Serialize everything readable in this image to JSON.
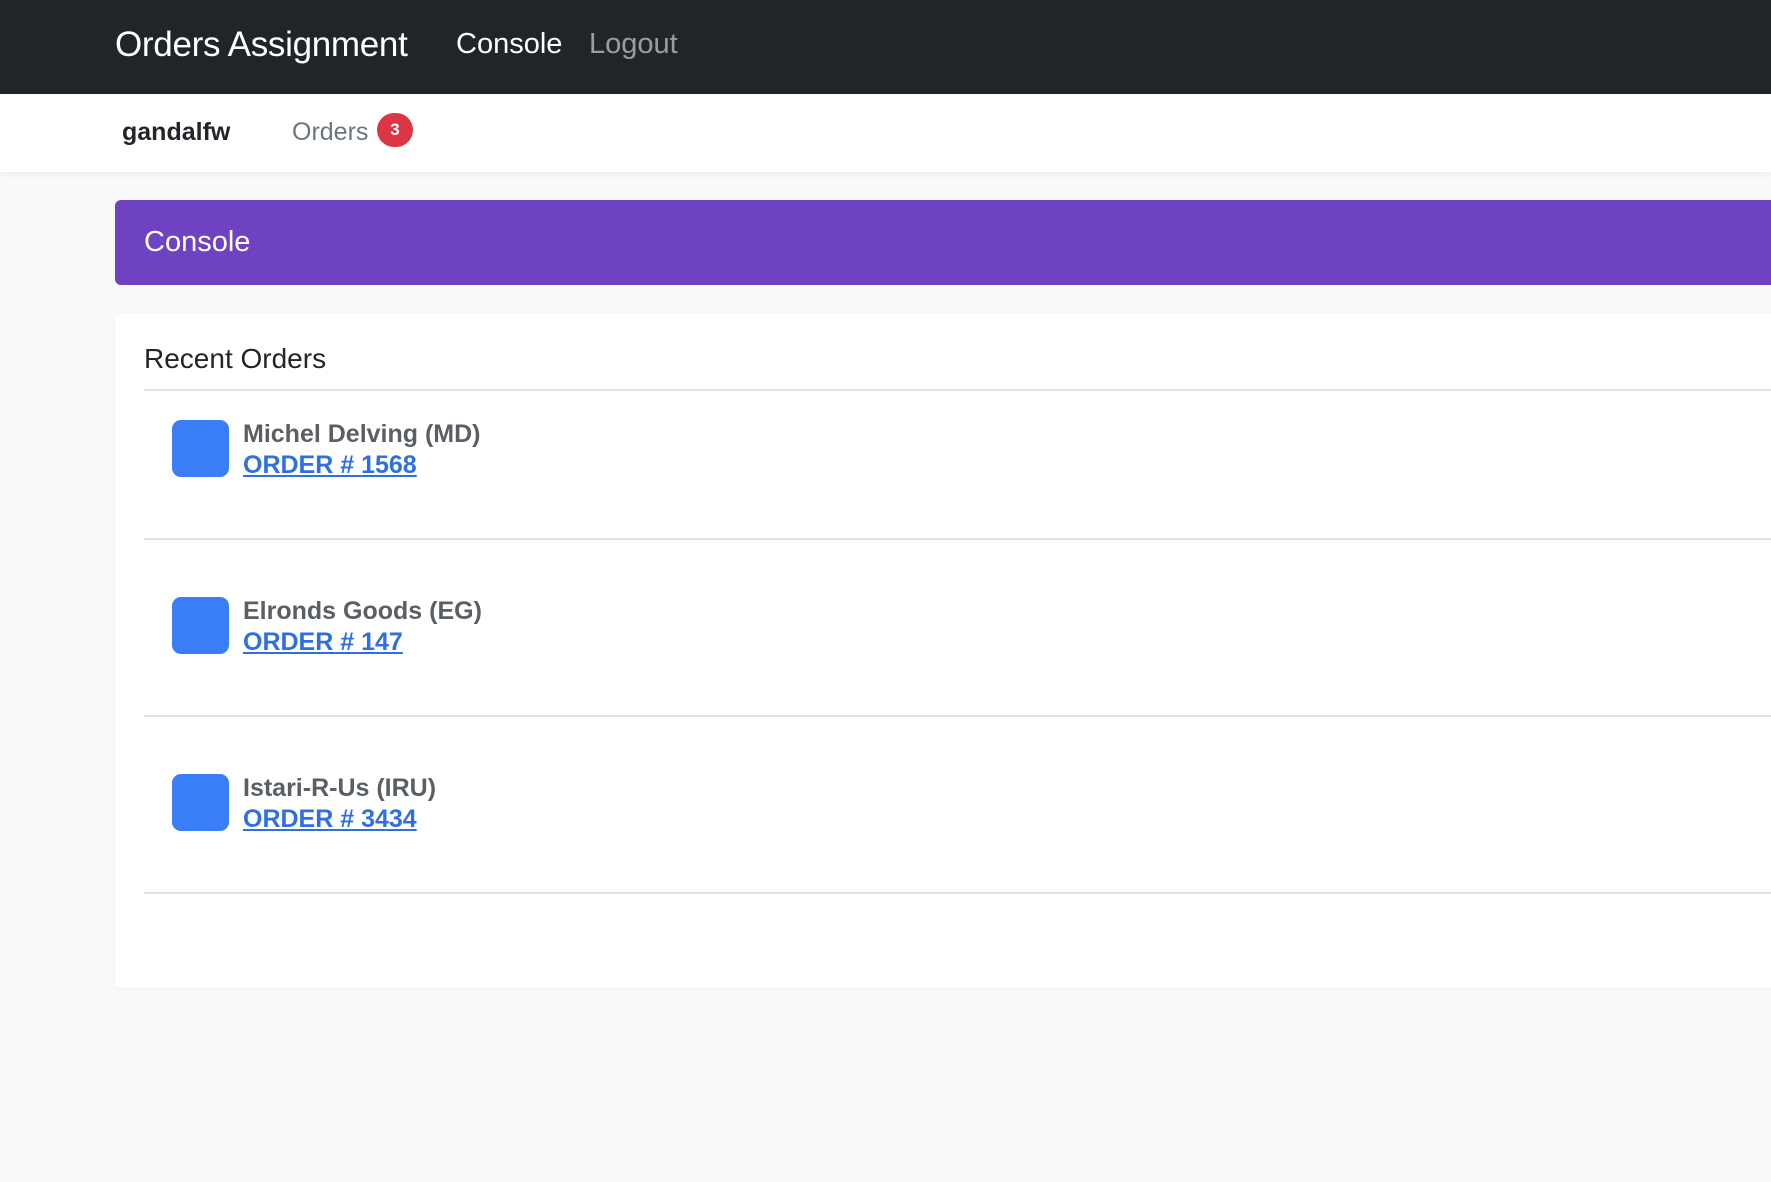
{
  "navbar": {
    "brand": "Orders Assignment",
    "links": [
      {
        "label": "Console",
        "active": true
      },
      {
        "label": "Logout",
        "active": false
      }
    ]
  },
  "subnav": {
    "username": "gandalfw",
    "orders_label": "Orders",
    "orders_count": "3"
  },
  "banner": {
    "title": "Console",
    "color": "#6f42c1"
  },
  "recent_orders": {
    "title": "Recent Orders",
    "items": [
      {
        "customer": "Michel Delving (MD)",
        "order": "ORDER # 1568"
      },
      {
        "customer": "Elronds Goods (EG)",
        "order": "ORDER # 147"
      },
      {
        "customer": "Istari-R-Us (IRU)",
        "order": "ORDER # 3434"
      }
    ]
  },
  "colors": {
    "navbar_bg": "#212529",
    "avatar": "#3a7ef6",
    "badge": "#dc3545",
    "link": "#2f6fe0"
  }
}
